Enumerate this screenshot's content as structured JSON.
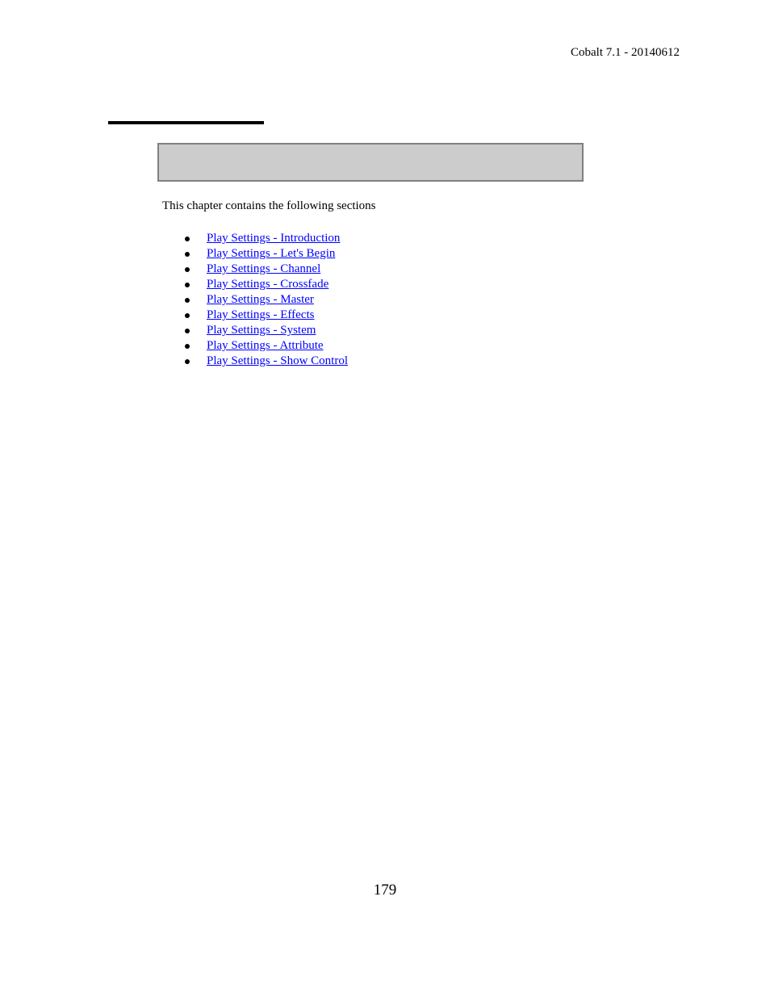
{
  "header": {
    "running_title": "Cobalt 7.1 - 20140612"
  },
  "chapter": {
    "intro": "This chapter contains the following sections",
    "sections": [
      {
        "label": "Play Settings - Introduction"
      },
      {
        "label": "Play Settings - Let's Begin"
      },
      {
        "label": "Play Settings - Channel"
      },
      {
        "label": "Play Settings - Crossfade"
      },
      {
        "label": "Play Settings - Master"
      },
      {
        "label": "Play Settings - Effects"
      },
      {
        "label": "Play Settings - System"
      },
      {
        "label": "Play Settings - Attribute"
      },
      {
        "label": "Play Settings - Show Control"
      }
    ]
  },
  "footer": {
    "page_number": "179"
  },
  "colors": {
    "link": "#0000ff",
    "box_fill": "#cccccc",
    "box_border": "#808080",
    "text": "#000000"
  }
}
